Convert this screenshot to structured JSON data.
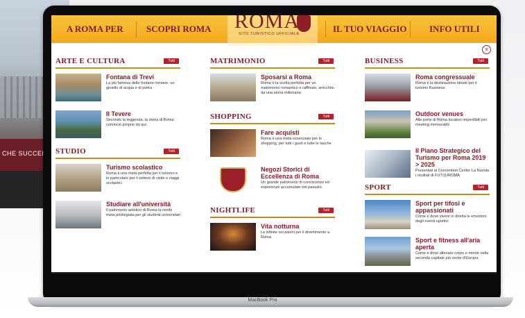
{
  "background": {
    "banner_text": "CHE SUCCEDE"
  },
  "laptop": {
    "brand": "MacBook Pro"
  },
  "nav": {
    "items": [
      "A ROMA PER",
      "SCOPRI ROMA",
      "IL TUO VIAGGIO",
      "INFO UTILI"
    ],
    "logo_word": "ROMA",
    "logo_sub": "SITO TURISTICO UFFICIALE"
  },
  "menu": {
    "close_symbol": "×",
    "tutti_label": "Tutti",
    "arte": {
      "title": "ARTE E CULTURA",
      "items": [
        {
          "title": "Fontana di Trevi",
          "desc": "La più famosa delle fontane romane: un gioiello di acqua e di pietra"
        },
        {
          "title": "Il Tevere",
          "desc": "Secondo la leggenda, la storia di Roma cominciò proprio da qui"
        }
      ]
    },
    "studio": {
      "title": "STUDIO",
      "items": [
        {
          "title": "Turismo scolastico",
          "desc": "Roma è una meta perfetta per il turismo e in particolare per il settore di visite e viaggi scolastici"
        },
        {
          "title": "Studiare all'università",
          "desc": "Il patrimonio artistico di Roma la rende meta privilegiata per gli studenti universitari"
        }
      ]
    },
    "matrimonio": {
      "title": "MATRIMONIO",
      "items": [
        {
          "title": "Sposarsi a Roma",
          "desc": "Roma è la scelta perfetta per un matrimonio romantico e raffinato, arricchito da una storia millenaria"
        }
      ]
    },
    "shopping": {
      "title": "SHOPPING",
      "items": [
        {
          "title": "Fare acquisti",
          "desc": "Roma è una meta essenziale per lo shopping, per tutti i gusti e tutte le tasche"
        },
        {
          "title": "Negozi Storici di Eccellenza di Roma",
          "desc": "Un grande patrimonio di conoscenze ed esperienze accumulate nel passato."
        }
      ]
    },
    "nightlife": {
      "title": "NIGHTLIFE",
      "items": [
        {
          "title": "Vita notturna",
          "desc": "Le infinite occasioni per il divertimento a Roma"
        }
      ]
    },
    "business": {
      "title": "BUSINESS",
      "items": [
        {
          "title": "Roma congressuale",
          "desc": "Roma è la destinazione ideale per il turismo Business"
        },
        {
          "title": "Outdoor venues",
          "desc": "Alle porte di Roma location imperdibili per meeting memorabili"
        },
        {
          "title": "Il Piano Strategico del Turismo per Roma 2019 > 2025",
          "desc": "Presentati al Convention Center La Nuvola i risultati di FUTOUROMA"
        }
      ]
    },
    "sport": {
      "title": "SPORT",
      "items": [
        {
          "title": "Sport per tifosi e appassionati",
          "desc": "Come e dove vivere in diretta le emozioni degli eventi sportivi"
        },
        {
          "title": "Sport e fitness all'aria aperta",
          "desc": "Come e dove allenare corpo e mente nella seconda capitale più verde d'Europa"
        }
      ]
    }
  }
}
